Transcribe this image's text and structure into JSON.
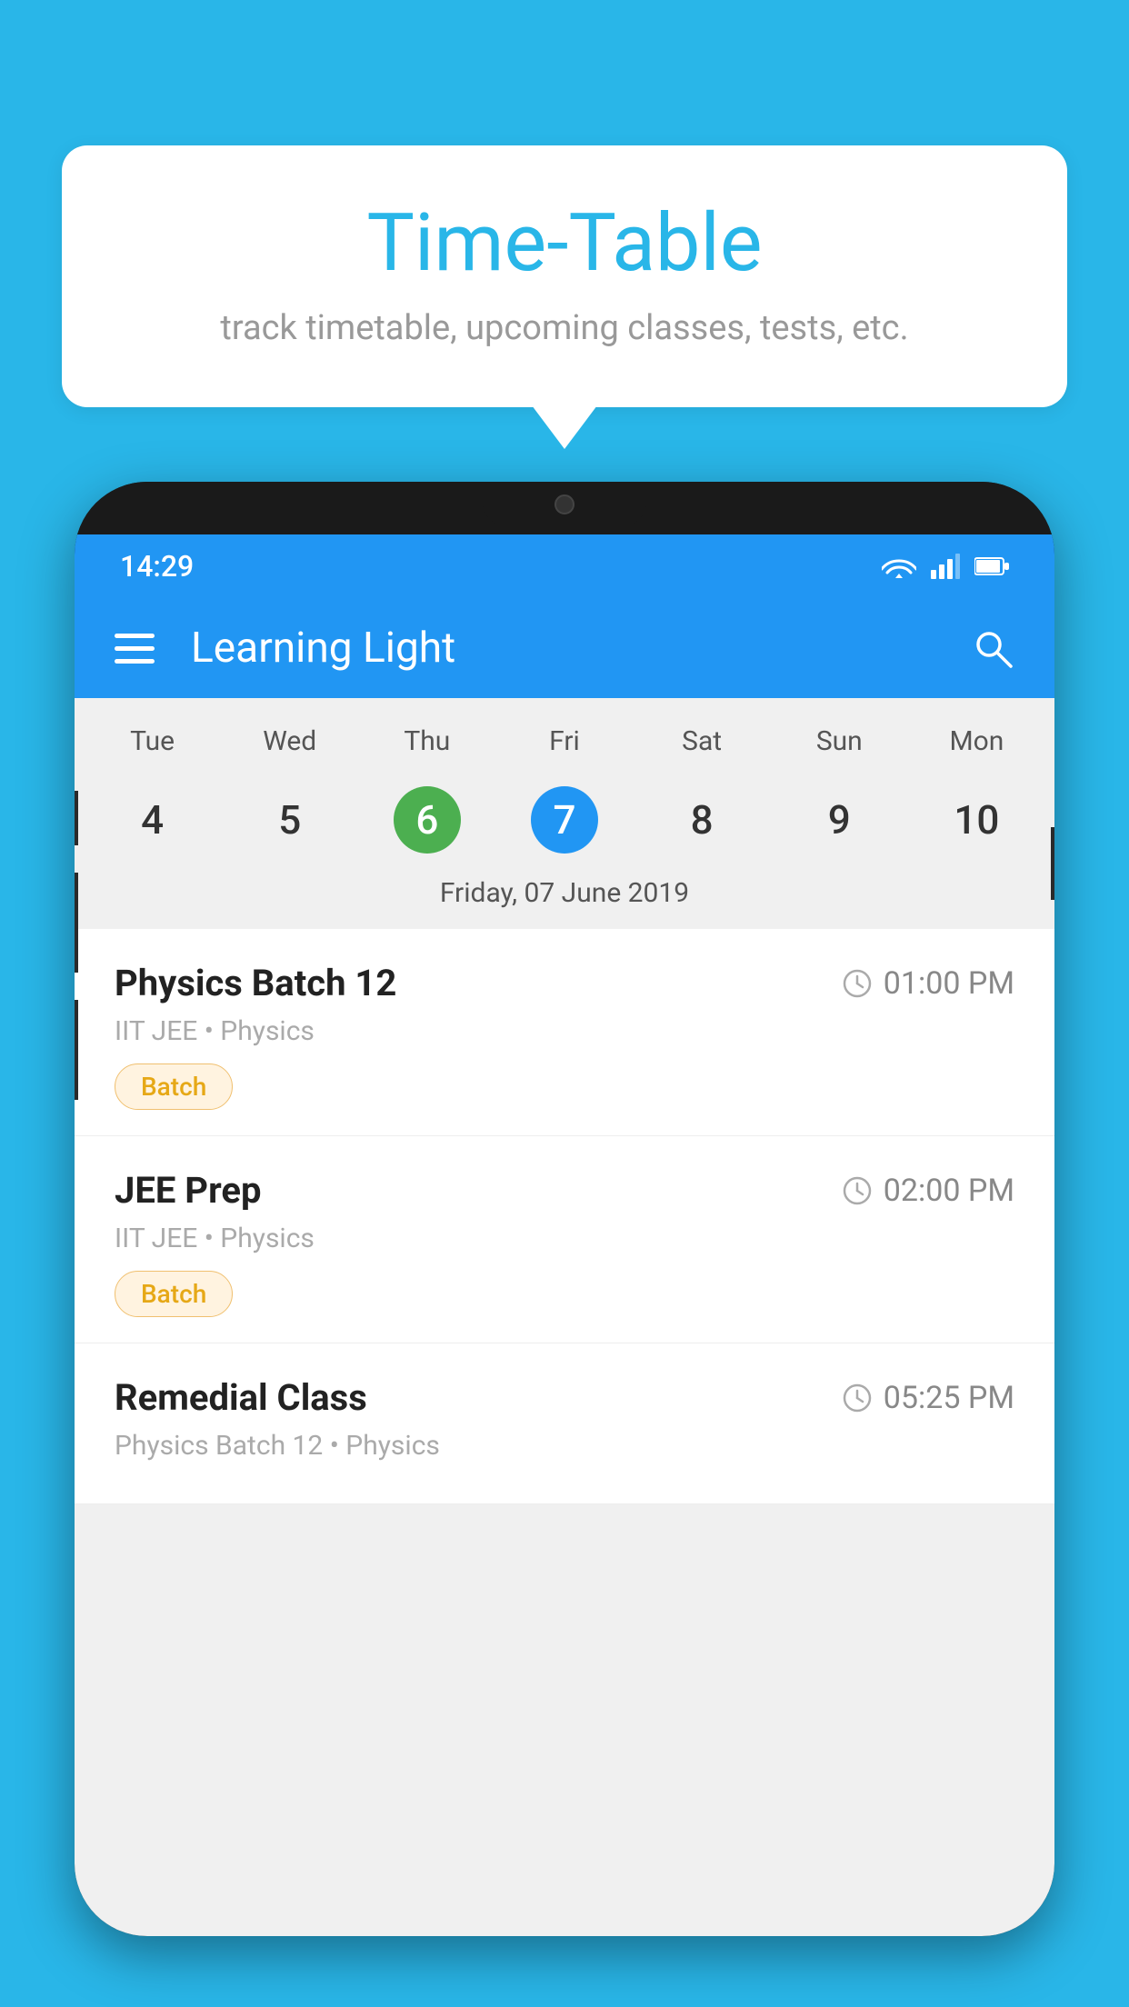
{
  "page": {
    "background_color": "#29b6e8"
  },
  "speech_bubble": {
    "title": "Time-Table",
    "subtitle": "track timetable, upcoming classes, tests, etc."
  },
  "status_bar": {
    "time": "14:29"
  },
  "app_bar": {
    "title": "Learning Light"
  },
  "calendar": {
    "day_labels": [
      "Tue",
      "Wed",
      "Thu",
      "Fri",
      "Sat",
      "Sun",
      "Mon"
    ],
    "dates": [
      {
        "num": "4",
        "type": "normal"
      },
      {
        "num": "5",
        "type": "normal"
      },
      {
        "num": "6",
        "type": "today"
      },
      {
        "num": "7",
        "type": "selected"
      },
      {
        "num": "8",
        "type": "normal"
      },
      {
        "num": "9",
        "type": "normal"
      },
      {
        "num": "10",
        "type": "normal"
      }
    ],
    "selected_date_label": "Friday, 07 June 2019"
  },
  "schedule_items": [
    {
      "title": "Physics Batch 12",
      "time": "01:00 PM",
      "meta": "IIT JEE • Physics",
      "badge": "Batch"
    },
    {
      "title": "JEE Prep",
      "time": "02:00 PM",
      "meta": "IIT JEE • Physics",
      "badge": "Batch"
    },
    {
      "title": "Remedial Class",
      "time": "05:25 PM",
      "meta": "Physics Batch 12 • Physics",
      "badge": null
    }
  ]
}
